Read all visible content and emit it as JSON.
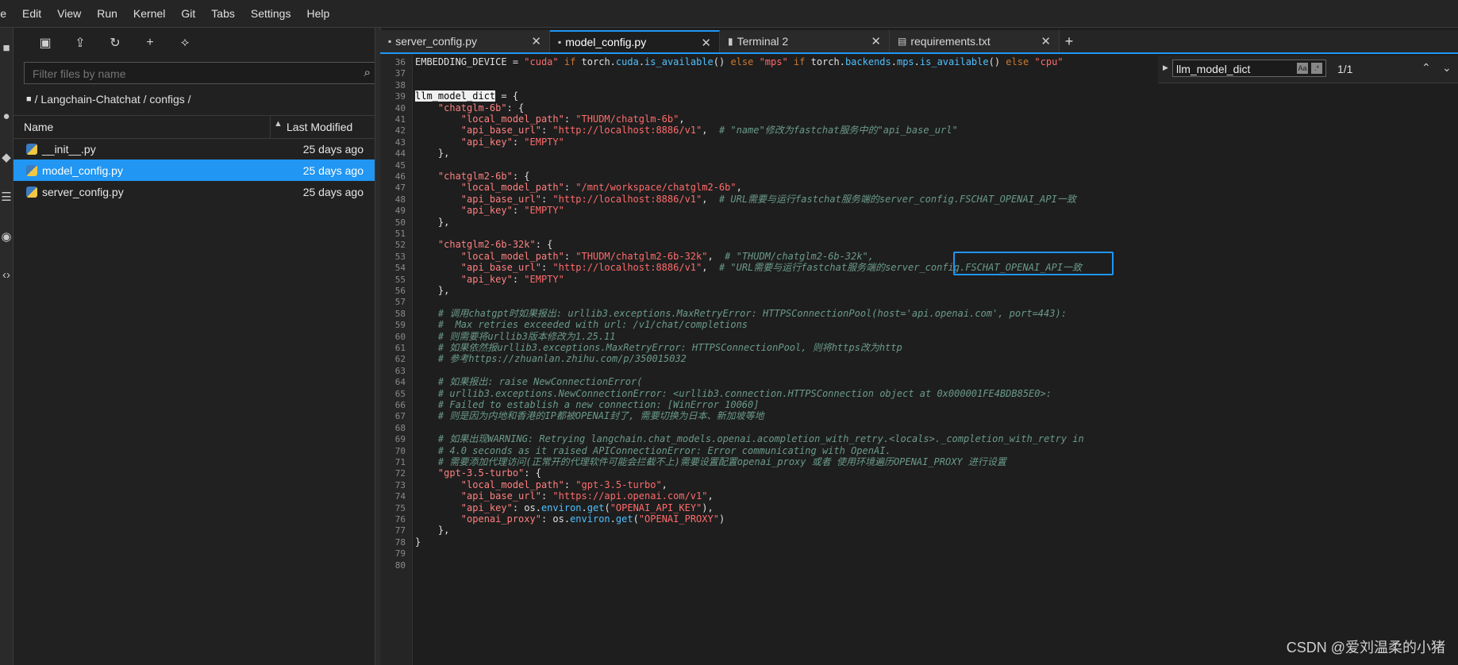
{
  "menubar": [
    "ile",
    "Edit",
    "View",
    "Run",
    "Kernel",
    "Git",
    "Tabs",
    "Settings",
    "Help"
  ],
  "filebrowser": {
    "filter_placeholder": "Filter files by name",
    "breadcrumb": "/ Langchain-Chatchat / configs /",
    "col_name": "Name",
    "col_modified": "Last Modified",
    "files": [
      {
        "name": "__init__.py",
        "modified": "25 days ago",
        "selected": false
      },
      {
        "name": "model_config.py",
        "modified": "25 days ago",
        "selected": true
      },
      {
        "name": "server_config.py",
        "modified": "25 days ago",
        "selected": false
      }
    ]
  },
  "tabs": [
    {
      "label": "server_config.py",
      "active": false,
      "icon": "python-icon"
    },
    {
      "label": "model_config.py",
      "active": true,
      "icon": "python-icon"
    },
    {
      "label": "Terminal 2",
      "active": false,
      "icon": "terminal-icon"
    },
    {
      "label": "requirements.txt",
      "active": false,
      "icon": "text-file-icon"
    }
  ],
  "find": {
    "query": "llm_model_dict",
    "count": "1/1"
  },
  "editor": {
    "lines": [
      {
        "n": "36",
        "segs": [
          [
            "d",
            "EMBEDDING_DEVICE = "
          ],
          [
            "s",
            "\"cuda\""
          ],
          [
            "k",
            " if "
          ],
          [
            "d",
            "torch."
          ],
          [
            "b",
            "cuda"
          ],
          [
            "d",
            "."
          ],
          [
            "b",
            "is_available"
          ],
          [
            "d",
            "() "
          ],
          [
            "k",
            "else "
          ],
          [
            "s",
            "\"mps\""
          ],
          [
            "k",
            " if "
          ],
          [
            "d",
            "torch."
          ],
          [
            "b",
            "backends"
          ],
          [
            "d",
            "."
          ],
          [
            "b",
            "mps"
          ],
          [
            "d",
            "."
          ],
          [
            "b",
            "is_available"
          ],
          [
            "d",
            "() "
          ],
          [
            "k",
            "else "
          ],
          [
            "s",
            "\"cpu\""
          ]
        ]
      },
      {
        "n": "37",
        "segs": []
      },
      {
        "n": "38",
        "segs": []
      },
      {
        "n": "39",
        "segs": [
          [
            "hl",
            "llm_model_dict"
          ],
          [
            "d",
            " = {"
          ]
        ]
      },
      {
        "n": "40",
        "segs": [
          [
            "d",
            "    "
          ],
          [
            "ky",
            "\"chatglm-6b\""
          ],
          [
            "d",
            ": {"
          ]
        ]
      },
      {
        "n": "41",
        "segs": [
          [
            "d",
            "        "
          ],
          [
            "ky",
            "\"local_model_path\""
          ],
          [
            "d",
            ": "
          ],
          [
            "s",
            "\"THUDM/chatglm-6b\""
          ],
          [
            "d",
            ","
          ]
        ]
      },
      {
        "n": "42",
        "segs": [
          [
            "d",
            "        "
          ],
          [
            "ky",
            "\"api_base_url\""
          ],
          [
            "d",
            ": "
          ],
          [
            "s",
            "\"http://localhost:8886/v1\""
          ],
          [
            "d",
            ",  "
          ],
          [
            "c",
            "# \"name\"修改为fastchat服务中的\"api_base_url\""
          ]
        ]
      },
      {
        "n": "43",
        "segs": [
          [
            "d",
            "        "
          ],
          [
            "ky",
            "\"api_key\""
          ],
          [
            "d",
            ": "
          ],
          [
            "s",
            "\"EMPTY\""
          ]
        ]
      },
      {
        "n": "44",
        "segs": [
          [
            "d",
            "    },"
          ]
        ]
      },
      {
        "n": "45",
        "segs": []
      },
      {
        "n": "46",
        "segs": [
          [
            "d",
            "    "
          ],
          [
            "ky",
            "\"chatglm2-6b\""
          ],
          [
            "d",
            ": {"
          ]
        ]
      },
      {
        "n": "47",
        "segs": [
          [
            "d",
            "        "
          ],
          [
            "ky",
            "\"local_model_path\""
          ],
          [
            "d",
            ": "
          ],
          [
            "s",
            "\"/mnt/workspace/chatglm2-6b\""
          ],
          [
            "d",
            ","
          ]
        ]
      },
      {
        "n": "48",
        "segs": [
          [
            "d",
            "        "
          ],
          [
            "ky",
            "\"api_base_url\""
          ],
          [
            "d",
            ": "
          ],
          [
            "s",
            "\"http://localhost:8886/v1\""
          ],
          [
            "d",
            ",  "
          ],
          [
            "c",
            "# URL需要与运行fastchat服务端的server_config.FSCHAT_OPENAI_API一致"
          ]
        ]
      },
      {
        "n": "49",
        "segs": [
          [
            "d",
            "        "
          ],
          [
            "ky",
            "\"api_key\""
          ],
          [
            "d",
            ": "
          ],
          [
            "s",
            "\"EMPTY\""
          ]
        ]
      },
      {
        "n": "50",
        "segs": [
          [
            "d",
            "    },"
          ]
        ]
      },
      {
        "n": "51",
        "segs": []
      },
      {
        "n": "52",
        "segs": [
          [
            "d",
            "    "
          ],
          [
            "ky",
            "\"chatglm2-6b-32k\""
          ],
          [
            "d",
            ": {"
          ]
        ]
      },
      {
        "n": "53",
        "segs": [
          [
            "d",
            "        "
          ],
          [
            "ky",
            "\"local_model_path\""
          ],
          [
            "d",
            ": "
          ],
          [
            "s",
            "\"THUDM/chatglm2-6b-32k\""
          ],
          [
            "d",
            ",  "
          ],
          [
            "c",
            "# \"THUDM/chatglm2-6b-32k\","
          ]
        ]
      },
      {
        "n": "54",
        "segs": [
          [
            "d",
            "        "
          ],
          [
            "ky",
            "\"api_base_url\""
          ],
          [
            "d",
            ": "
          ],
          [
            "s",
            "\"http://localhost:8886/v1\""
          ],
          [
            "d",
            ",  "
          ],
          [
            "c",
            "# \"URL需要与运行fastchat服务端的server_config.FSCHAT_OPENAI_API一致"
          ]
        ]
      },
      {
        "n": "55",
        "segs": [
          [
            "d",
            "        "
          ],
          [
            "ky",
            "\"api_key\""
          ],
          [
            "d",
            ": "
          ],
          [
            "s",
            "\"EMPTY\""
          ]
        ]
      },
      {
        "n": "56",
        "segs": [
          [
            "d",
            "    },"
          ]
        ]
      },
      {
        "n": "57",
        "segs": []
      },
      {
        "n": "58",
        "segs": [
          [
            "d",
            "    "
          ],
          [
            "c",
            "# 调用chatgpt时如果报出: urllib3.exceptions.MaxRetryError: HTTPSConnectionPool(host='api.openai.com', port=443):"
          ]
        ]
      },
      {
        "n": "59",
        "segs": [
          [
            "d",
            "    "
          ],
          [
            "c",
            "#  Max retries exceeded with url: /v1/chat/completions"
          ]
        ]
      },
      {
        "n": "60",
        "segs": [
          [
            "d",
            "    "
          ],
          [
            "c",
            "# 则需要将urllib3版本修改为1.25.11"
          ]
        ]
      },
      {
        "n": "61",
        "segs": [
          [
            "d",
            "    "
          ],
          [
            "c",
            "# 如果依然报urllib3.exceptions.MaxRetryError: HTTPSConnectionPool, 则将https改为http"
          ]
        ]
      },
      {
        "n": "62",
        "segs": [
          [
            "d",
            "    "
          ],
          [
            "c",
            "# 参考https://zhuanlan.zhihu.com/p/350015032"
          ]
        ]
      },
      {
        "n": "63",
        "segs": []
      },
      {
        "n": "64",
        "segs": [
          [
            "d",
            "    "
          ],
          [
            "c",
            "# 如果报出: raise NewConnectionError("
          ]
        ]
      },
      {
        "n": "65",
        "segs": [
          [
            "d",
            "    "
          ],
          [
            "c",
            "# urllib3.exceptions.NewConnectionError: <urllib3.connection.HTTPSConnection object at 0x000001FE4BDB85E0>:"
          ]
        ]
      },
      {
        "n": "66",
        "segs": [
          [
            "d",
            "    "
          ],
          [
            "c",
            "# Failed to establish a new connection: [WinError 10060]"
          ]
        ]
      },
      {
        "n": "67",
        "segs": [
          [
            "d",
            "    "
          ],
          [
            "c",
            "# 则是因为内地和香港的IP都被OPENAI封了, 需要切换为日本、新加坡等地"
          ]
        ]
      },
      {
        "n": "68",
        "segs": []
      },
      {
        "n": "69",
        "segs": [
          [
            "d",
            "    "
          ],
          [
            "c",
            "# 如果出现WARNING: Retrying langchain.chat_models.openai.acompletion_with_retry.<locals>._completion_with_retry in"
          ]
        ]
      },
      {
        "n": "70",
        "segs": [
          [
            "d",
            "    "
          ],
          [
            "c",
            "# 4.0 seconds as it raised APIConnectionError: Error communicating with OpenAI."
          ]
        ]
      },
      {
        "n": "71",
        "segs": [
          [
            "d",
            "    "
          ],
          [
            "c",
            "# 需要添加代理访问(正常开的代理软件可能会拦截不上)需要设置配置openai_proxy 或者 使用环境遍历OPENAI_PROXY 进行设置"
          ]
        ]
      },
      {
        "n": "72",
        "segs": [
          [
            "d",
            "    "
          ],
          [
            "ky",
            "\"gpt-3.5-turbo\""
          ],
          [
            "d",
            ": {"
          ]
        ]
      },
      {
        "n": "73",
        "segs": [
          [
            "d",
            "        "
          ],
          [
            "ky",
            "\"local_model_path\""
          ],
          [
            "d",
            ": "
          ],
          [
            "s",
            "\"gpt-3.5-turbo\""
          ],
          [
            "d",
            ","
          ]
        ]
      },
      {
        "n": "74",
        "segs": [
          [
            "d",
            "        "
          ],
          [
            "ky",
            "\"api_base_url\""
          ],
          [
            "d",
            ": "
          ],
          [
            "s",
            "\"https://api.openai.com/v1\""
          ],
          [
            "d",
            ","
          ]
        ]
      },
      {
        "n": "75",
        "segs": [
          [
            "d",
            "        "
          ],
          [
            "ky",
            "\"api_key\""
          ],
          [
            "d",
            ": os."
          ],
          [
            "b",
            "environ"
          ],
          [
            "d",
            "."
          ],
          [
            "b",
            "get"
          ],
          [
            "d",
            "("
          ],
          [
            "s",
            "\"OPENAI_API_KEY\""
          ],
          [
            "d",
            "),"
          ]
        ]
      },
      {
        "n": "76",
        "segs": [
          [
            "d",
            "        "
          ],
          [
            "ky",
            "\"openai_proxy\""
          ],
          [
            "d",
            ": os."
          ],
          [
            "b",
            "environ"
          ],
          [
            "d",
            "."
          ],
          [
            "b",
            "get"
          ],
          [
            "d",
            "("
          ],
          [
            "s",
            "\"OPENAI_PROXY\""
          ],
          [
            "d",
            ")"
          ]
        ]
      },
      {
        "n": "77",
        "segs": [
          [
            "d",
            "    },"
          ]
        ]
      },
      {
        "n": "78",
        "segs": [
          [
            "d",
            "}"
          ]
        ]
      },
      {
        "n": "79",
        "segs": []
      },
      {
        "n": "80",
        "segs": []
      }
    ]
  },
  "watermark": "CSDN @爱刘温柔的小猪"
}
